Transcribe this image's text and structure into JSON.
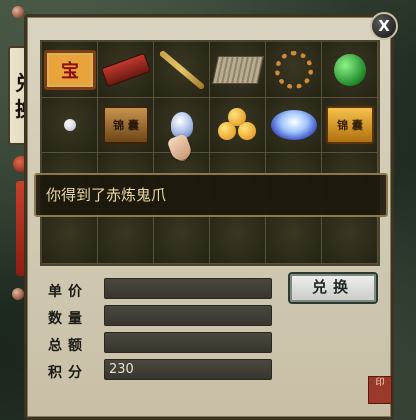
{
  "window": {
    "side_tab_chars": [
      "兑",
      "换"
    ],
    "close_label": "X"
  },
  "grid": {
    "rows": 4,
    "cols": 6,
    "items": [
      {
        "row": 0,
        "col": 0,
        "icon": "treasure-placard-icon",
        "label": "宝"
      },
      {
        "row": 0,
        "col": 1,
        "icon": "red-box-icon",
        "label": ""
      },
      {
        "row": 0,
        "col": 2,
        "icon": "bamboo-flute-icon",
        "label": ""
      },
      {
        "row": 0,
        "col": 3,
        "icon": "scroll-mat-icon",
        "label": ""
      },
      {
        "row": 0,
        "col": 4,
        "icon": "bead-necklace-icon",
        "label": ""
      },
      {
        "row": 0,
        "col": 5,
        "icon": "jade-disc-icon",
        "label": ""
      },
      {
        "row": 1,
        "col": 0,
        "icon": "white-pearl-icon",
        "label": ""
      },
      {
        "row": 1,
        "col": 1,
        "icon": "bronze-chest-icon",
        "label": "锦 囊"
      },
      {
        "row": 1,
        "col": 2,
        "icon": "crystal-bell-icon",
        "label": ""
      },
      {
        "row": 1,
        "col": 3,
        "icon": "golden-orbs-icon",
        "label": ""
      },
      {
        "row": 1,
        "col": 4,
        "icon": "blue-lotus-crystal-icon",
        "label": ""
      },
      {
        "row": 1,
        "col": 5,
        "icon": "gold-chest-icon",
        "label": "锦 囊"
      }
    ]
  },
  "message": "你得到了赤炼鬼爪",
  "form": {
    "unit_price_label": "单价",
    "quantity_label": "数量",
    "total_label": "总额",
    "points_label": "积分",
    "unit_price_value": "",
    "quantity_value": "",
    "total_value": "",
    "points_value": "230"
  },
  "exchange_button": "兑换",
  "seal_text": "印"
}
